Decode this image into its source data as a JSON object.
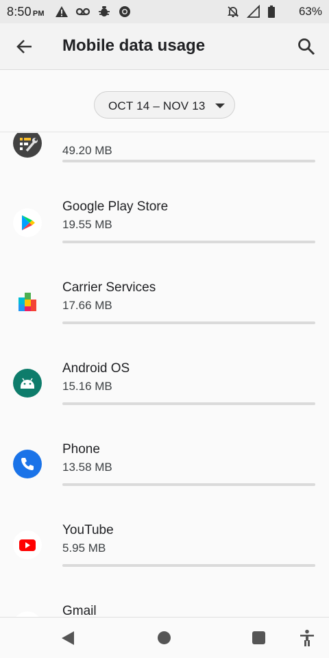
{
  "status_bar": {
    "time": "8:50",
    "ampm": "PM",
    "battery_pct": "63%",
    "left_icons": [
      "warning-icon",
      "voicemail-icon",
      "bug-icon",
      "chrome-icon"
    ],
    "right_icons": [
      "notifications-off-icon",
      "signal-icon",
      "battery-icon"
    ]
  },
  "app_bar": {
    "title": "Mobile data usage",
    "back_icon": "arrow-back-icon",
    "search_icon": "search-icon"
  },
  "range": {
    "label": "OCT 14 – NOV 13",
    "caret_icon": "dropdown-caret-icon"
  },
  "apps": [
    {
      "name": "",
      "usage": "49.20 MB",
      "icon": "tools-icon"
    },
    {
      "name": "Google Play Store",
      "usage": "19.55 MB",
      "icon": "play-store-icon"
    },
    {
      "name": "Carrier Services",
      "usage": "17.66 MB",
      "icon": "carrier-services-icon"
    },
    {
      "name": "Android OS",
      "usage": "15.16 MB",
      "icon": "android-icon"
    },
    {
      "name": "Phone",
      "usage": "13.58 MB",
      "icon": "phone-icon"
    },
    {
      "name": "YouTube",
      "usage": "5.95 MB",
      "icon": "youtube-icon"
    },
    {
      "name": "Gmail",
      "usage": "",
      "icon": "gmail-icon"
    }
  ],
  "nav_bar": {
    "icons": [
      "nav-back-icon",
      "nav-home-icon",
      "nav-recents-icon",
      "accessibility-icon"
    ]
  }
}
